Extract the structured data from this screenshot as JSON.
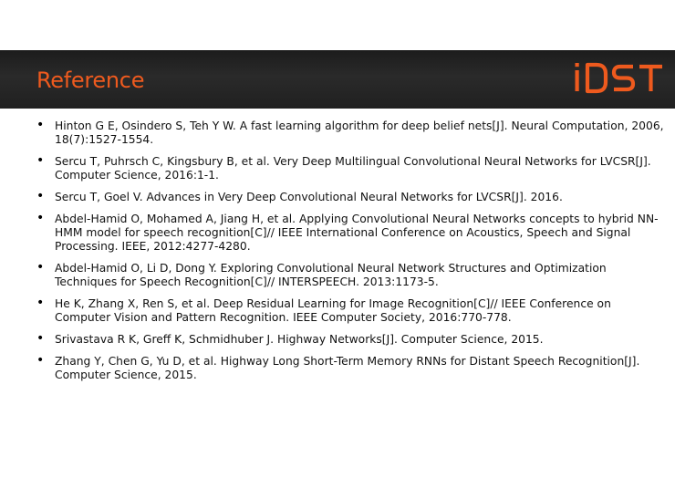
{
  "slide": {
    "title": "Reference",
    "logo_text": "iDST",
    "colors": {
      "accent": "#ee5a1e",
      "header_bar": "#222222",
      "text": "#111111"
    }
  },
  "references": [
    {
      "bullet_icon": "bullet-dot",
      "text": "Hinton G E, Osindero S, Teh Y W. A fast learning algorithm for deep belief nets[J]. Neural Computation, 2006, 18(7):1527-1554."
    },
    {
      "bullet_icon": "bullet-dot",
      "text": "Sercu T, Puhrsch C, Kingsbury B, et al. Very Deep Multilingual Convolutional Neural Networks for LVCSR[J]. Computer Science, 2016:1-1."
    },
    {
      "bullet_icon": "bullet-dot",
      "text": "Sercu T, Goel V. Advances in Very Deep Convolutional Neural Networks for LVCSR[J]. 2016."
    },
    {
      "bullet_icon": "bullet-dot",
      "text": "Abdel-Hamid O, Mohamed A, Jiang H, et al. Applying Convolutional Neural Networks concepts to hybrid NN-HMM model for speech recognition[C]// IEEE International Conference on Acoustics, Speech and Signal Processing. IEEE, 2012:4277-4280."
    },
    {
      "bullet_icon": "bullet-dot",
      "text": "Abdel-Hamid O, Li D, Dong Y. Exploring Convolutional Neural Network Structures and Optimization Techniques for Speech Recognition[C]// INTERSPEECH. 2013:1173-5."
    },
    {
      "bullet_icon": "bullet-dot",
      "text": "He K, Zhang X, Ren S, et al. Deep Residual Learning for Image Recognition[C]// IEEE Conference on Computer Vision and Pattern Recognition. IEEE Computer Society, 2016:770-778."
    },
    {
      "bullet_icon": "bullet-dot",
      "text": "Srivastava R K, Greff K, Schmidhuber J. Highway Networks[J]. Computer Science, 2015."
    },
    {
      "bullet_icon": "bullet-dot",
      "text": "Zhang Y, Chen G, Yu D, et al. Highway Long Short-Term Memory RNNs for Distant Speech Recognition[J]. Computer Science, 2015."
    }
  ]
}
